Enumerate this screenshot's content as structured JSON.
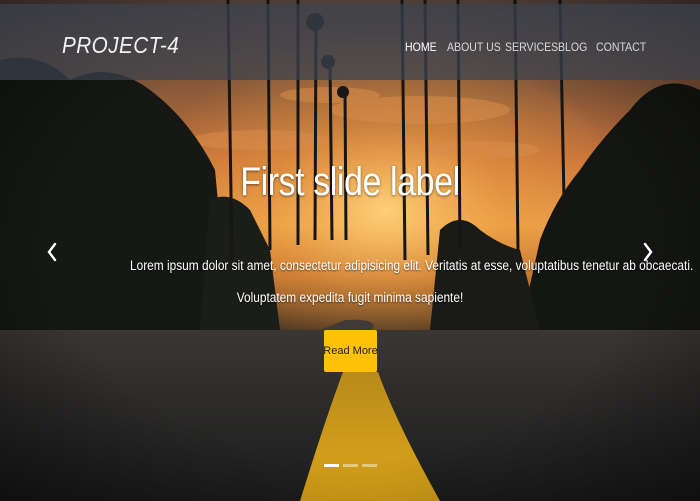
{
  "nav": {
    "brand": "PROJECT-4",
    "items": [
      {
        "label": "HOME"
      },
      {
        "label": "ABOUT US"
      },
      {
        "label": "SERVICES"
      },
      {
        "label": "BLOG"
      },
      {
        "label": "CONTACT"
      }
    ]
  },
  "carousel": {
    "title": "First slide label",
    "text_line1": "Lorem ipsum dolor sit amet, consectetur adipisicing elit. Veritatis at esse, voluptatibus tenetur ab obcaecati.",
    "text_line2": "Voluptatem expedita fugit minima sapiente!",
    "button_label": "Read More",
    "prev_icon": "chevron-left-icon",
    "next_icon": "chevron-right-icon",
    "slide_count": 3,
    "active_slide": 1,
    "accent_color": "#ffc107"
  }
}
